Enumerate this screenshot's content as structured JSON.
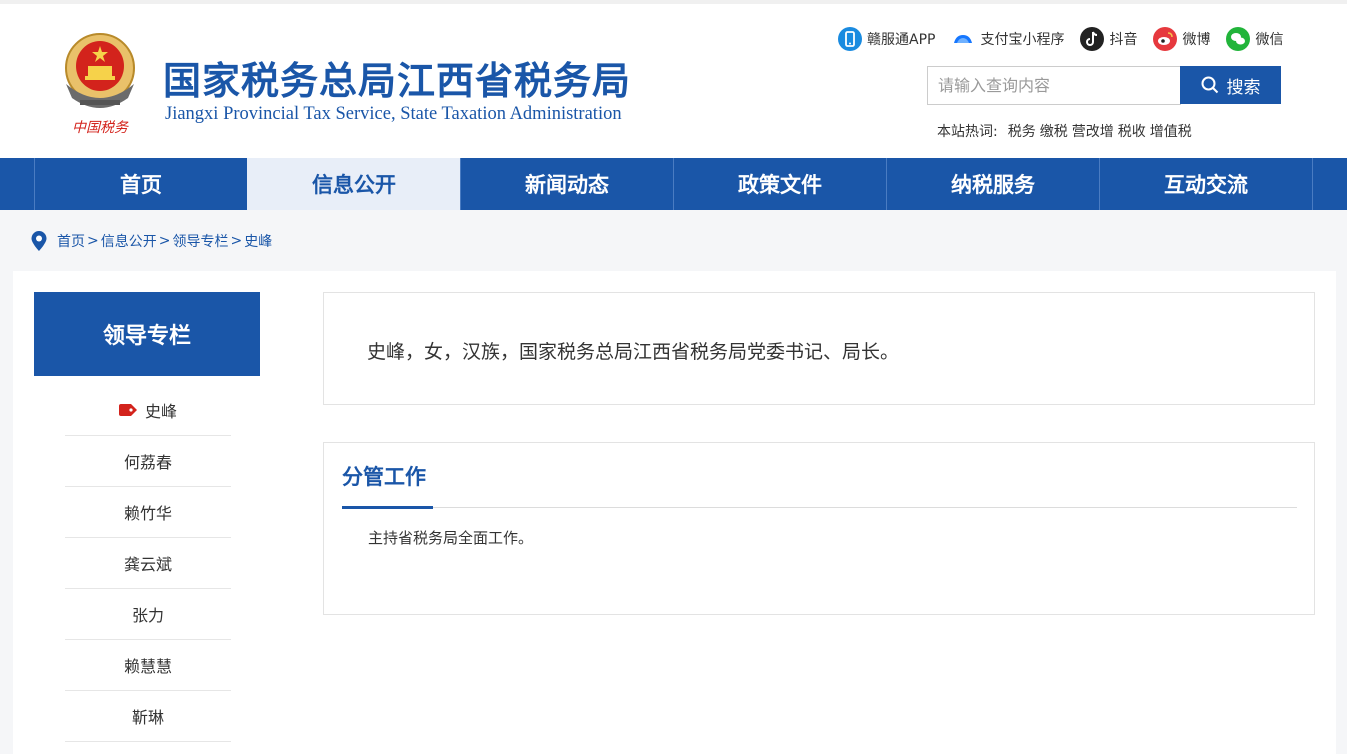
{
  "header": {
    "title": "国家税务总局江西省税务局",
    "subtitle": "Jiangxi Provincial Tax Service, State Taxation Administration",
    "emblem_caption": "中国税务",
    "social": [
      {
        "label": "赣服通APP",
        "icon": "app-icon",
        "color": "#1a8be0"
      },
      {
        "label": "支付宝小程序",
        "icon": "alipay-icon",
        "color": "#1677ff"
      },
      {
        "label": "抖音",
        "icon": "douyin-icon",
        "color": "#222222"
      },
      {
        "label": "微博",
        "icon": "weibo-icon",
        "color": "#e6393e"
      },
      {
        "label": "微信",
        "icon": "wechat-icon",
        "color": "#21b43a"
      }
    ],
    "search": {
      "placeholder": "请输入查询内容",
      "button_label": "搜索"
    },
    "hotwords": {
      "label": "本站热词:",
      "items": [
        "税务",
        "缴税",
        "营改增",
        "税收",
        "增值税"
      ]
    }
  },
  "nav": {
    "items": [
      "首页",
      "信息公开",
      "新闻动态",
      "政策文件",
      "纳税服务",
      "互动交流"
    ],
    "active_index": 1
  },
  "breadcrumb": [
    "首页",
    "信息公开",
    "领导专栏",
    "史峰"
  ],
  "sidebar": {
    "title": "领导专栏",
    "items": [
      "史峰",
      "何荔春",
      "赖竹华",
      "龚云斌",
      "张力",
      "赖慧慧",
      "靳琳"
    ],
    "active_index": 0
  },
  "content": {
    "intro": "史峰，女，汉族，国家税务总局江西省税务局党委书记、局长。",
    "duty_title": "分管工作",
    "duty_text": "主持省税务局全面工作。"
  },
  "colors": {
    "brand_blue": "#1a56a8",
    "emblem_red": "#d3231c"
  }
}
